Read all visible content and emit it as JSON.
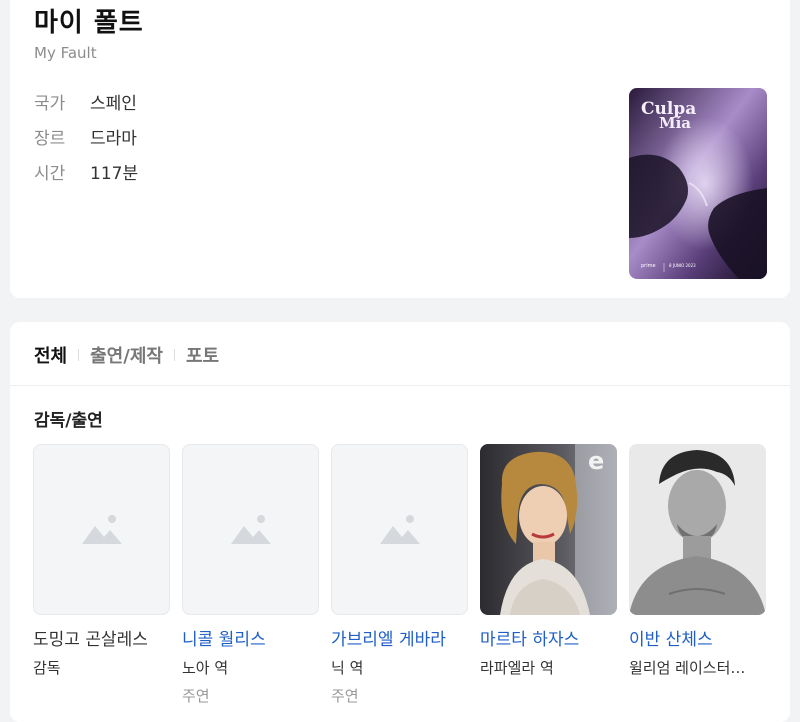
{
  "movie": {
    "title": "마이 폴트",
    "original_title": "My Fault",
    "info": [
      {
        "label": "국가",
        "value": "스페인"
      },
      {
        "label": "장르",
        "value": "드라마"
      },
      {
        "label": "시간",
        "value": "117분"
      }
    ],
    "poster": {
      "title_line1": "Culpa",
      "title_line2": "Mía",
      "brand": "prime",
      "release": "8 JUNIO 2023"
    }
  },
  "tabs": [
    {
      "label": "전체",
      "active": true
    },
    {
      "label": "출연/제작",
      "active": false
    },
    {
      "label": "포토",
      "active": false
    }
  ],
  "section_title": "감독/출연",
  "people": [
    {
      "name": "도밍고 곤살레스",
      "role": "감독",
      "type": "",
      "has_link": false,
      "has_photo": false
    },
    {
      "name": "니콜 월리스",
      "role": "노아 역",
      "type": "주연",
      "has_link": true,
      "has_photo": false
    },
    {
      "name": "가브리엘 게바라",
      "role": "닉 역",
      "type": "주연",
      "has_link": true,
      "has_photo": false
    },
    {
      "name": "마르타 하자스",
      "role": "라파엘라 역",
      "type": "",
      "has_link": true,
      "has_photo": true
    },
    {
      "name": "이반 산체스",
      "role": "윌리엄 레이스터…",
      "type": "",
      "has_link": true,
      "has_photo": true
    }
  ],
  "colors": {
    "link": "#1f5fc7",
    "muted": "#8c8c8c",
    "background": "#f2f3f5"
  }
}
